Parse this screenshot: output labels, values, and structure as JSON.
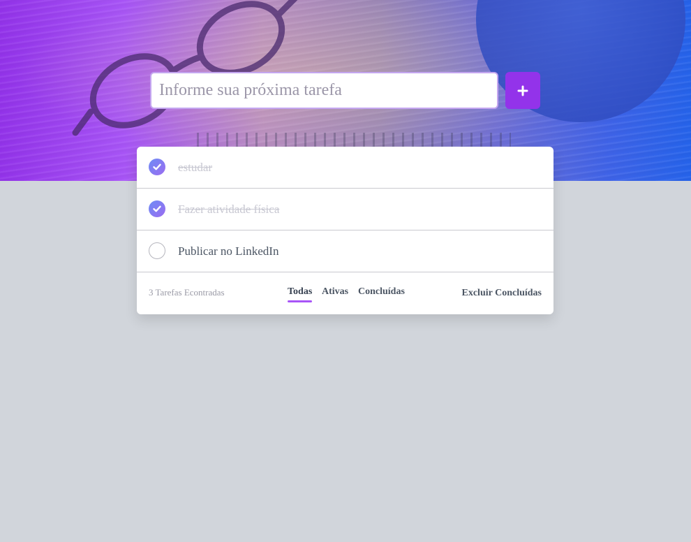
{
  "input": {
    "placeholder": "Informe sua próxima tarefa"
  },
  "add_button": {
    "icon": "plus-icon"
  },
  "tasks": [
    {
      "label": "estudar",
      "done": true
    },
    {
      "label": "Fazer atividade física",
      "done": true
    },
    {
      "label": "Publicar no LinkedIn",
      "done": false
    }
  ],
  "footer": {
    "count_text": "3 Tarefas Econtradas",
    "filters": [
      "Todas",
      "Ativas",
      "Concluídas"
    ],
    "active_filter": "Todas",
    "clear_label": "Excluir Concluídas"
  },
  "colors": {
    "accent": "#9333ea",
    "check_gradient_start": "#6d8cf5",
    "check_gradient_end": "#9b6cf0",
    "background": "#d1d5db"
  }
}
